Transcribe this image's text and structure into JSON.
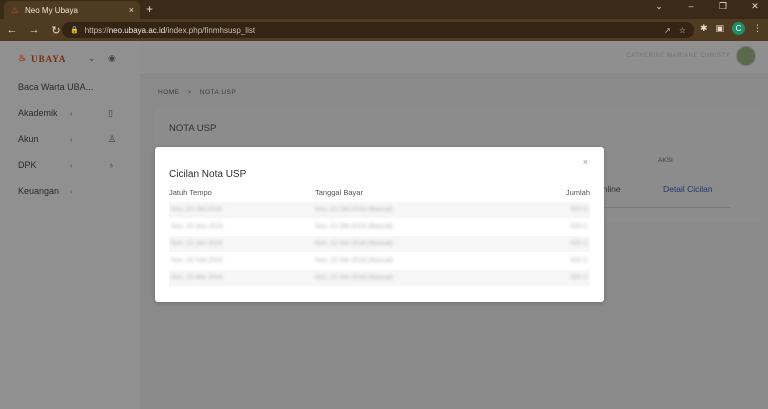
{
  "browser": {
    "tab_title": "Neo My Ubaya",
    "tab_close": "×",
    "new_tab": "+",
    "url_scheme": "https://",
    "url_host": "neo.ubaya.ac.id",
    "url_path": "/index.php/finmhsusp_list",
    "profile_initial": "C",
    "window_controls": [
      "⌄",
      "–",
      "❐",
      "✕"
    ]
  },
  "sidebar": {
    "logo_text": "UBAYA",
    "items": [
      {
        "label": "Baca Warta UBA...",
        "chevron": "",
        "icon": ""
      },
      {
        "label": "Akademik",
        "chevron": "‹",
        "icon": "▯"
      },
      {
        "label": "Akun",
        "chevron": "‹",
        "icon": "♙"
      },
      {
        "label": "DPK",
        "chevron": "‹",
        "icon": "♁"
      },
      {
        "label": "Keuangan",
        "chevron": "‹",
        "icon": ""
      }
    ]
  },
  "topbar": {
    "user_name": "CATHERINE MARIANE CHRISTY"
  },
  "breadcrumb": {
    "home": "HOME",
    "separator": ">",
    "current": "NOTA USP"
  },
  "card": {
    "title": "NOTA USP",
    "col_partial": "A",
    "col_aksi": "AKSI",
    "row_status": "Online",
    "row_action": "Detail Cicilan"
  },
  "modal": {
    "title": "Cicilan Nota USP",
    "close": "×",
    "headers": {
      "due": "Jatuh Tempo",
      "paid": "Tanggal Bayar",
      "amount": "Jumlah"
    },
    "rows": [
      {
        "due": "Sen, 20 Okt 2018",
        "paid": "Sen, 22 Okt 2018 (Manual)",
        "amount": "500 C"
      },
      {
        "due": "Sen, 15 Des 2018",
        "paid": "Sen, 22 Okt 2018 (Manual)",
        "amount": "500 C"
      },
      {
        "due": "Sen, 15 Jan 2019",
        "paid": "Sen, 22 Okt 2018 (Manual)",
        "amount": "500 C"
      },
      {
        "due": "Sen, 15 Feb 2019",
        "paid": "Sen, 22 Okt 2018 (Manual)",
        "amount": "500 C"
      },
      {
        "due": "Sen, 15 Mar 2019",
        "paid": "Sen, 22 Okt 2018 (Manual)",
        "amount": "500 C"
      }
    ]
  }
}
